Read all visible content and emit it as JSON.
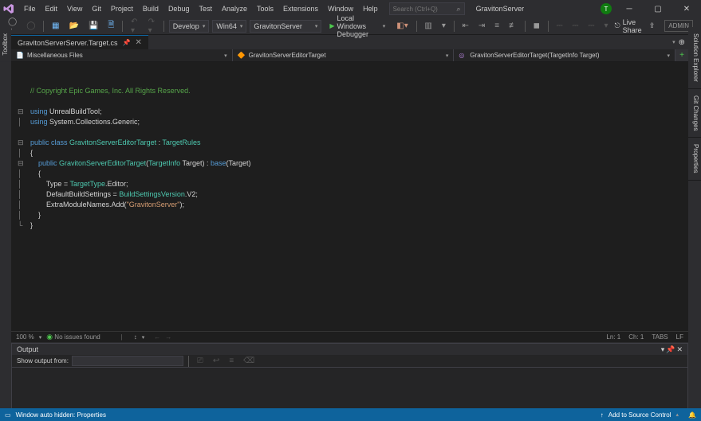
{
  "menu": [
    "File",
    "Edit",
    "View",
    "Git",
    "Project",
    "Build",
    "Debug",
    "Test",
    "Analyze",
    "Tools",
    "Extensions",
    "Window",
    "Help"
  ],
  "search": {
    "placeholder": "Search (Ctrl+Q)"
  },
  "solution_name": "GravitonServer",
  "admin": "ADMIN",
  "toolbar": {
    "config": "Develop",
    "platform": "Win64",
    "project": "GravitonServer",
    "debugger": "Local Windows Debugger",
    "liveshare": "Live Share"
  },
  "tab": {
    "name": "GravitonServerServer.Target.cs"
  },
  "nav": {
    "seg1": "Miscellaneous Files",
    "seg2": "GravitonServerEditorTarget",
    "seg3": "GravitonServerEditorTarget(TargetInfo Target)"
  },
  "code": {
    "l1": "// Copyright Epic Games, Inc. All Rights Reserved.",
    "l2a": "using",
    "l2b": " UnrealBuildTool;",
    "l3a": "using",
    "l3b": " System.Collections.Generic;",
    "l4a": "public class ",
    "l4b": "GravitonServerEditorTarget",
    "l4c": " : ",
    "l4d": "TargetRules",
    "l5": "{",
    "l6a": "    public ",
    "l6b": "GravitonServerEditorTarget",
    "l6c": "(",
    "l6d": "TargetInfo",
    "l6e": " Target) : ",
    "l6f": "base",
    "l6g": "(Target)",
    "l7": "    {",
    "l8a": "        Type = ",
    "l8b": "TargetType",
    "l8c": ".Editor;",
    "l9a": "        DefaultBuildSettings = ",
    "l9b": "BuildSettingsVersion",
    "l9c": ".V2;",
    "l10a": "        ExtraModuleNames.Add(",
    "l10b": "\"GravitonServer\"",
    "l10c": ");",
    "l11": "    }",
    "l12": "}"
  },
  "editor_status": {
    "zoom": "100 %",
    "issues": "No issues found",
    "ln": "Ln: 1",
    "ch": "Ch: 1",
    "tabs": "TABS",
    "lf": "LF"
  },
  "output": {
    "title": "Output",
    "from_label": "Show output from:"
  },
  "statusbar": {
    "left": "Window auto hidden: Properties",
    "scc": "Add to Source Control"
  },
  "side": {
    "sol": "Solution Explorer",
    "git": "Git Changes",
    "prop": "Properties",
    "tbx": "Toolbox"
  }
}
